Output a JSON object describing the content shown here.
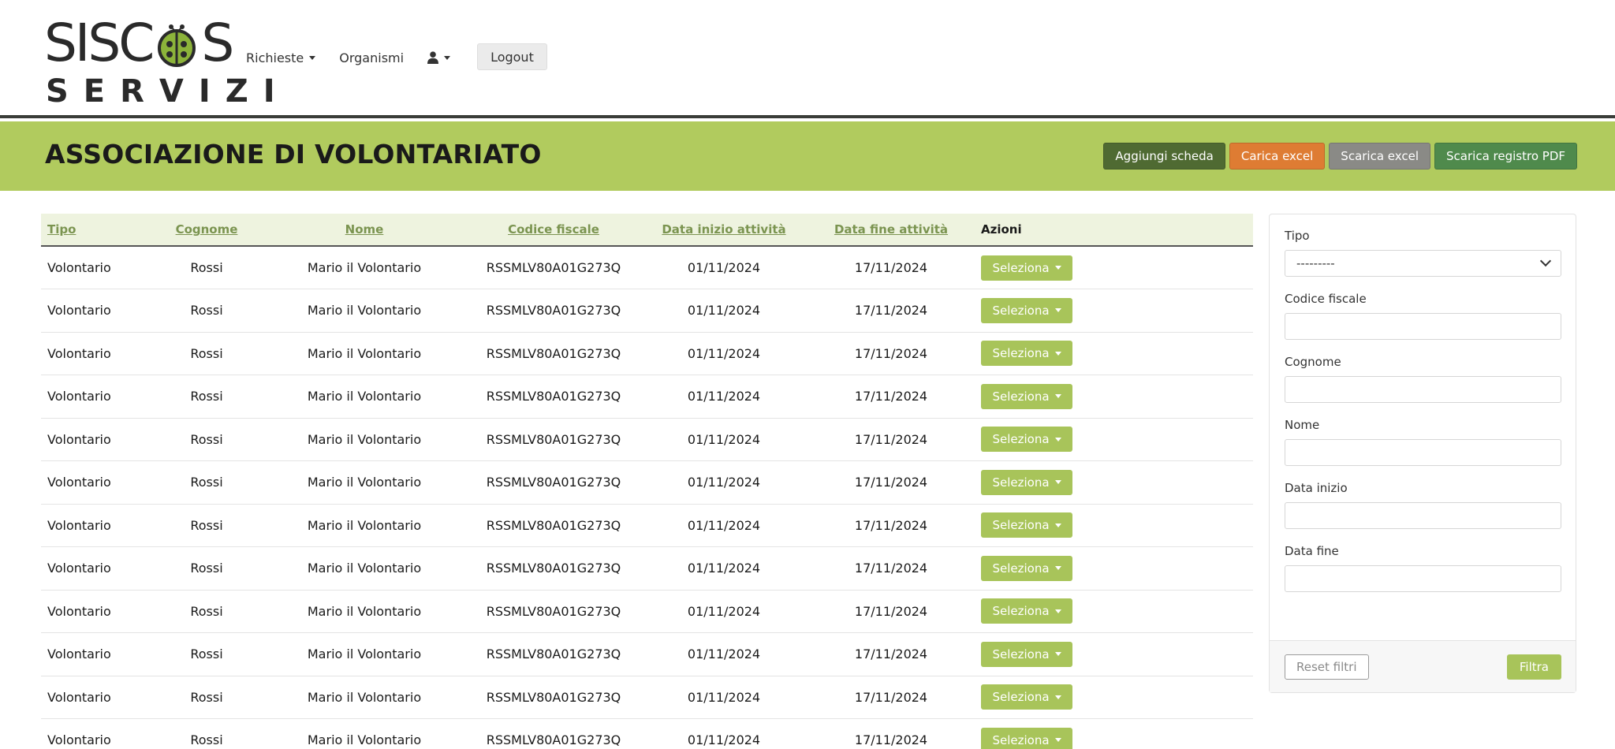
{
  "brand": {
    "logo_top": "SISC S",
    "logo_top_left": "SISC",
    "logo_top_right": "S",
    "logo_bottom": "SERVIZI",
    "accent_color": "#b1cb5e"
  },
  "nav": {
    "richieste": "Richieste",
    "organismi": "Organismi",
    "user_icon": "user-icon",
    "logout": "Logout"
  },
  "header": {
    "title": "ASSOCIAZIONE DI VOLONTARIATO",
    "actions": {
      "add": "Aggiungi scheda",
      "upload": "Carica excel",
      "download": "Scarica excel",
      "pdf": "Scarica registro PDF"
    }
  },
  "table": {
    "columns": [
      "Tipo",
      "Cognome",
      "Nome",
      "Codice fiscale",
      "Data inizio attività",
      "Data fine attività",
      "Azioni"
    ],
    "action_label": "Seleziona",
    "rows": [
      [
        "Volontario",
        "Rossi",
        "Mario il Volontario",
        "RSSMLV80A01G273Q",
        "01/11/2024",
        "17/11/2024"
      ],
      [
        "Volontario",
        "Rossi",
        "Mario il Volontario",
        "RSSMLV80A01G273Q",
        "01/11/2024",
        "17/11/2024"
      ],
      [
        "Volontario",
        "Rossi",
        "Mario il Volontario",
        "RSSMLV80A01G273Q",
        "01/11/2024",
        "17/11/2024"
      ],
      [
        "Volontario",
        "Rossi",
        "Mario il Volontario",
        "RSSMLV80A01G273Q",
        "01/11/2024",
        "17/11/2024"
      ],
      [
        "Volontario",
        "Rossi",
        "Mario il Volontario",
        "RSSMLV80A01G273Q",
        "01/11/2024",
        "17/11/2024"
      ],
      [
        "Volontario",
        "Rossi",
        "Mario il Volontario",
        "RSSMLV80A01G273Q",
        "01/11/2024",
        "17/11/2024"
      ],
      [
        "Volontario",
        "Rossi",
        "Mario il Volontario",
        "RSSMLV80A01G273Q",
        "01/11/2024",
        "17/11/2024"
      ],
      [
        "Volontario",
        "Rossi",
        "Mario il Volontario",
        "RSSMLV80A01G273Q",
        "01/11/2024",
        "17/11/2024"
      ],
      [
        "Volontario",
        "Rossi",
        "Mario il Volontario",
        "RSSMLV80A01G273Q",
        "01/11/2024",
        "17/11/2024"
      ],
      [
        "Volontario",
        "Rossi",
        "Mario il Volontario",
        "RSSMLV80A01G273Q",
        "01/11/2024",
        "17/11/2024"
      ],
      [
        "Volontario",
        "Rossi",
        "Mario il Volontario",
        "RSSMLV80A01G273Q",
        "01/11/2024",
        "17/11/2024"
      ],
      [
        "Volontario",
        "Rossi",
        "Mario il Volontario",
        "RSSMLV80A01G273Q",
        "01/11/2024",
        "17/11/2024"
      ]
    ]
  },
  "filters": {
    "tipo_label": "Tipo",
    "tipo_value": "---------",
    "codice_label": "Codice fiscale",
    "cognome_label": "Cognome",
    "nome_label": "Nome",
    "inizio_label": "Data inizio",
    "fine_label": "Data fine",
    "reset": "Reset filtri",
    "apply": "Filtra"
  }
}
